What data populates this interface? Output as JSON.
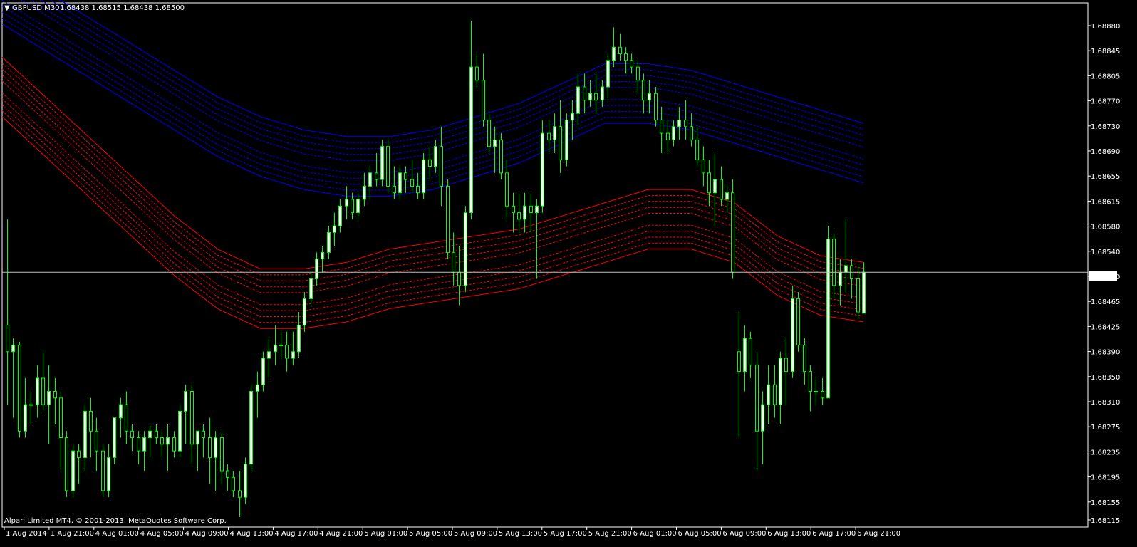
{
  "header": {
    "symbol": "GBPUSD,M30",
    "ohlc": "1.68438 1.68515 1.68438 1.68500"
  },
  "copyright": "Alpari Limited MT4, © 2001-2013, MetaQuotes Software Corp.",
  "colors": {
    "background": "#000000",
    "frame": "#ffffff",
    "candle": "#00ff00",
    "bull_body": "#ffffff",
    "bear_body": "#000000",
    "upper_band": "#0000ff",
    "lower_band": "#ff0000",
    "price_line": "#c0c0c0",
    "text": "#ffffff"
  },
  "chart_data": {
    "type": "candlestick",
    "timeframe": "M30",
    "price_range": [
      1.68115,
      1.68907
    ],
    "y_ticks": [
      "1.68880",
      "1.68845",
      "1.68805",
      "1.68770",
      "1.68730",
      "1.68690",
      "1.68655",
      "1.68615",
      "1.68580",
      "1.68540",
      "1.68500",
      "1.68465",
      "1.68425",
      "1.68390",
      "1.68350",
      "1.68310",
      "1.68275",
      "1.68235",
      "1.68195",
      "1.68155",
      "1.68115"
    ],
    "x_ticks": [
      "1 Aug 2014",
      "1 Aug 21:00",
      "4 Aug 01:00",
      "4 Aug 05:00",
      "4 Aug 09:00",
      "4 Aug 13:00",
      "4 Aug 17:00",
      "4 Aug 21:00",
      "5 Aug 01:00",
      "5 Aug 05:00",
      "5 Aug 09:00",
      "5 Aug 13:00",
      "5 Aug 17:00",
      "5 Aug 21:00",
      "6 Aug 01:00",
      "6 Aug 05:00",
      "6 Aug 09:00",
      "6 Aug 13:00",
      "6 Aug 17:00",
      "6 Aug 21:00"
    ],
    "current_price": "1.68500",
    "ohlc": [
      [
        1.6842,
        1.6858,
        1.683,
        1.6838
      ],
      [
        1.6838,
        1.684,
        1.6828,
        1.6839
      ],
      [
        1.6839,
        1.68395,
        1.6825,
        1.6826
      ],
      [
        1.6826,
        1.6834,
        1.6825,
        1.683
      ],
      [
        1.683,
        1.6832,
        1.6827,
        1.683
      ],
      [
        1.683,
        1.6836,
        1.6828,
        1.6834
      ],
      [
        1.6834,
        1.6838,
        1.6829,
        1.683
      ],
      [
        1.683,
        1.6836,
        1.6824,
        1.6832
      ],
      [
        1.6832,
        1.6834,
        1.6827,
        1.6831
      ],
      [
        1.6831,
        1.6832,
        1.682,
        1.6825
      ],
      [
        1.6825,
        1.6826,
        1.6816,
        1.6817
      ],
      [
        1.6817,
        1.6824,
        1.6816,
        1.6823
      ],
      [
        1.6823,
        1.6824,
        1.6818,
        1.6822
      ],
      [
        1.6822,
        1.683,
        1.682,
        1.6829
      ],
      [
        1.6829,
        1.6831,
        1.6822,
        1.6826
      ],
      [
        1.6826,
        1.6828,
        1.682,
        1.6823
      ],
      [
        1.6823,
        1.6824,
        1.6816,
        1.6817
      ],
      [
        1.6817,
        1.6824,
        1.6816,
        1.6822
      ],
      [
        1.6822,
        1.6828,
        1.6821,
        1.6828
      ],
      [
        1.6828,
        1.6831,
        1.6825,
        1.683
      ],
      [
        1.683,
        1.6832,
        1.6824,
        1.6826
      ],
      [
        1.6826,
        1.6827,
        1.6823,
        1.6825
      ],
      [
        1.6825,
        1.6826,
        1.6821,
        1.6823
      ],
      [
        1.6823,
        1.6826,
        1.682,
        1.6825
      ],
      [
        1.6825,
        1.6827,
        1.6822,
        1.6826
      ],
      [
        1.6826,
        1.6827,
        1.6824,
        1.6825
      ],
      [
        1.6825,
        1.6826,
        1.6822,
        1.6824
      ],
      [
        1.6824,
        1.6827,
        1.682,
        1.6825
      ],
      [
        1.6825,
        1.6826,
        1.6822,
        1.6823
      ],
      [
        1.6823,
        1.683,
        1.6822,
        1.6829
      ],
      [
        1.6829,
        1.6833,
        1.6824,
        1.6832
      ],
      [
        1.6832,
        1.6833,
        1.6821,
        1.6824
      ],
      [
        1.6824,
        1.6826,
        1.682,
        1.6826
      ],
      [
        1.6826,
        1.6827,
        1.6822,
        1.6825
      ],
      [
        1.6825,
        1.6828,
        1.6818,
        1.6822
      ],
      [
        1.6822,
        1.6826,
        1.6817,
        1.6825
      ],
      [
        1.6825,
        1.6826,
        1.6818,
        1.682
      ],
      [
        1.682,
        1.6821,
        1.6817,
        1.6819
      ],
      [
        1.6819,
        1.682,
        1.6816,
        1.6817
      ],
      [
        1.6817,
        1.682,
        1.6813,
        1.6816
      ],
      [
        1.6816,
        1.6822,
        1.6815,
        1.6821
      ],
      [
        1.6821,
        1.6833,
        1.682,
        1.6832
      ],
      [
        1.6832,
        1.6835,
        1.6828,
        1.6833
      ],
      [
        1.6833,
        1.6838,
        1.6832,
        1.6837
      ],
      [
        1.6837,
        1.684,
        1.6834,
        1.6838
      ],
      [
        1.6838,
        1.6842,
        1.6836,
        1.6839
      ],
      [
        1.6839,
        1.6841,
        1.6837,
        1.6839
      ],
      [
        1.6839,
        1.6841,
        1.6835,
        1.6837
      ],
      [
        1.6837,
        1.6841,
        1.6836,
        1.6838
      ],
      [
        1.6838,
        1.6844,
        1.6837,
        1.6842
      ],
      [
        1.6842,
        1.6847,
        1.6841,
        1.6846
      ],
      [
        1.6846,
        1.685,
        1.6845,
        1.6849
      ],
      [
        1.6849,
        1.6853,
        1.6848,
        1.6852
      ],
      [
        1.6852,
        1.6854,
        1.685,
        1.6853
      ],
      [
        1.6853,
        1.6857,
        1.6852,
        1.6856
      ],
      [
        1.6856,
        1.6859,
        1.6854,
        1.6857
      ],
      [
        1.6857,
        1.6861,
        1.6856,
        1.686
      ],
      [
        1.686,
        1.6863,
        1.6858,
        1.6861
      ],
      [
        1.6861,
        1.6862,
        1.6858,
        1.6859
      ],
      [
        1.6859,
        1.6862,
        1.6858,
        1.6861
      ],
      [
        1.6861,
        1.6865,
        1.686,
        1.6863
      ],
      [
        1.6863,
        1.6866,
        1.6861,
        1.6865
      ],
      [
        1.6865,
        1.6868,
        1.6863,
        1.6864
      ],
      [
        1.6864,
        1.687,
        1.6863,
        1.6869
      ],
      [
        1.6869,
        1.687,
        1.6862,
        1.6863
      ],
      [
        1.6863,
        1.6866,
        1.6861,
        1.6862
      ],
      [
        1.6862,
        1.6866,
        1.6861,
        1.6865
      ],
      [
        1.6865,
        1.6866,
        1.6862,
        1.6864
      ],
      [
        1.6864,
        1.6867,
        1.6862,
        1.6863
      ],
      [
        1.6863,
        1.6865,
        1.6861,
        1.6862
      ],
      [
        1.6862,
        1.6868,
        1.6861,
        1.6867
      ],
      [
        1.6867,
        1.6869,
        1.6864,
        1.6866
      ],
      [
        1.6866,
        1.687,
        1.6865,
        1.6869
      ],
      [
        1.6869,
        1.6872,
        1.686,
        1.6863
      ],
      [
        1.6863,
        1.6864,
        1.6852,
        1.6853
      ],
      [
        1.6853,
        1.6856,
        1.6848,
        1.685
      ],
      [
        1.685,
        1.6854,
        1.6845,
        1.6848
      ],
      [
        1.6848,
        1.686,
        1.6847,
        1.6859
      ],
      [
        1.6859,
        1.6888,
        1.6858,
        1.6881
      ],
      [
        1.6881,
        1.6883,
        1.6878,
        1.6879
      ],
      [
        1.6879,
        1.6883,
        1.6872,
        1.6873
      ],
      [
        1.6873,
        1.6874,
        1.6868,
        1.6869
      ],
      [
        1.6869,
        1.6872,
        1.6865,
        1.687
      ],
      [
        1.687,
        1.6871,
        1.6864,
        1.6865
      ],
      [
        1.6865,
        1.6867,
        1.6858,
        1.686
      ],
      [
        1.686,
        1.6862,
        1.6856,
        1.6859
      ],
      [
        1.6859,
        1.6862,
        1.6856,
        1.6858
      ],
      [
        1.6858,
        1.6862,
        1.6856,
        1.686
      ],
      [
        1.686,
        1.6862,
        1.6856,
        1.6859
      ],
      [
        1.6859,
        1.6861,
        1.6849,
        1.686
      ],
      [
        1.686,
        1.6873,
        1.6859,
        1.6871
      ],
      [
        1.6871,
        1.6873,
        1.6868,
        1.687
      ],
      [
        1.687,
        1.6874,
        1.6868,
        1.6872
      ],
      [
        1.6872,
        1.6876,
        1.6865,
        1.6867
      ],
      [
        1.6867,
        1.6874,
        1.6866,
        1.6873
      ],
      [
        1.6873,
        1.6876,
        1.687,
        1.6874
      ],
      [
        1.6874,
        1.688,
        1.6872,
        1.6878
      ],
      [
        1.6878,
        1.688,
        1.6874,
        1.6876
      ],
      [
        1.6876,
        1.6879,
        1.6875,
        1.6877
      ],
      [
        1.6877,
        1.688,
        1.6874,
        1.6876
      ],
      [
        1.6876,
        1.6879,
        1.6875,
        1.6878
      ],
      [
        1.6878,
        1.6883,
        1.6876,
        1.6882
      ],
      [
        1.6882,
        1.6887,
        1.6881,
        1.6884
      ],
      [
        1.6884,
        1.6886,
        1.6882,
        1.6883
      ],
      [
        1.6883,
        1.6884,
        1.688,
        1.6882
      ],
      [
        1.6882,
        1.6883,
        1.688,
        1.6881
      ],
      [
        1.6881,
        1.6882,
        1.6877,
        1.6879
      ],
      [
        1.6879,
        1.688,
        1.6874,
        1.6876
      ],
      [
        1.6876,
        1.6879,
        1.6874,
        1.6877
      ],
      [
        1.6877,
        1.6878,
        1.6872,
        1.6873
      ],
      [
        1.6873,
        1.6875,
        1.6868,
        1.6871
      ],
      [
        1.6871,
        1.6873,
        1.6868,
        1.687
      ],
      [
        1.687,
        1.6873,
        1.6869,
        1.6872
      ],
      [
        1.6872,
        1.6875,
        1.687,
        1.6873
      ],
      [
        1.6873,
        1.6876,
        1.687,
        1.6872
      ],
      [
        1.6872,
        1.6874,
        1.6869,
        1.687
      ],
      [
        1.687,
        1.6872,
        1.6866,
        1.6867
      ],
      [
        1.6867,
        1.6869,
        1.6863,
        1.6865
      ],
      [
        1.6865,
        1.6867,
        1.686,
        1.6862
      ],
      [
        1.6862,
        1.6868,
        1.6857,
        1.6864
      ],
      [
        1.6864,
        1.6866,
        1.686,
        1.6861
      ],
      [
        1.6861,
        1.6863,
        1.6859,
        1.6862
      ],
      [
        1.6862,
        1.6864,
        1.6849,
        1.685
      ],
      [
        1.6838,
        1.6844,
        1.6825,
        1.6835
      ],
      [
        1.6835,
        1.6842,
        1.6832,
        1.684
      ],
      [
        1.684,
        1.6841,
        1.6834,
        1.6836
      ],
      [
        1.6836,
        1.6838,
        1.682,
        1.6826
      ],
      [
        1.6826,
        1.6832,
        1.6821,
        1.683
      ],
      [
        1.683,
        1.6836,
        1.6827,
        1.6833
      ],
      [
        1.6833,
        1.6836,
        1.6828,
        1.683
      ],
      [
        1.683,
        1.6838,
        1.6827,
        1.6837
      ],
      [
        1.6837,
        1.684,
        1.683,
        1.6835
      ],
      [
        1.6835,
        1.6848,
        1.6834,
        1.6846
      ],
      [
        1.6846,
        1.6847,
        1.6838,
        1.6839
      ],
      [
        1.6839,
        1.684,
        1.6833,
        1.6835
      ],
      [
        1.6835,
        1.6836,
        1.6829,
        1.6832
      ],
      [
        1.6832,
        1.6834,
        1.683,
        1.6832
      ],
      [
        1.6832,
        1.6834,
        1.683,
        1.6831
      ],
      [
        1.6831,
        1.6857,
        1.6831,
        1.6855
      ],
      [
        1.6855,
        1.6856,
        1.6846,
        1.6848
      ],
      [
        1.6848,
        1.6852,
        1.6845,
        1.685
      ],
      [
        1.685,
        1.6858,
        1.6847,
        1.6851
      ],
      [
        1.6851,
        1.6852,
        1.6846,
        1.6849
      ],
      [
        1.6849,
        1.6851,
        1.6843,
        1.6844
      ],
      [
        1.68438,
        1.68515,
        1.68438,
        1.685
      ]
    ],
    "envelopes": [
      {
        "name": "upper",
        "line_style": "solid-outer-dashed-inner",
        "center": [
          1.6892,
          1.6888,
          1.6884,
          1.688,
          1.6876,
          1.6872,
          1.6869,
          1.6867,
          1.6866,
          1.6866,
          1.6867,
          1.6869,
          1.6871,
          1.6874,
          1.6877,
          1.6877,
          1.6876,
          1.6874,
          1.6872,
          1.687,
          1.6868
        ],
        "half_width": 0.00045
      },
      {
        "name": "lower",
        "line_style": "solid-outer-dashed-inner",
        "center": [
          1.6878,
          1.6872,
          1.6866,
          1.686,
          1.6854,
          1.6849,
          1.6846,
          1.6846,
          1.6847,
          1.6849,
          1.685,
          1.6851,
          1.6852,
          1.6854,
          1.6856,
          1.6858,
          1.6858,
          1.6856,
          1.6851,
          1.6848,
          1.6847
        ],
        "half_width": 0.00045
      }
    ]
  }
}
